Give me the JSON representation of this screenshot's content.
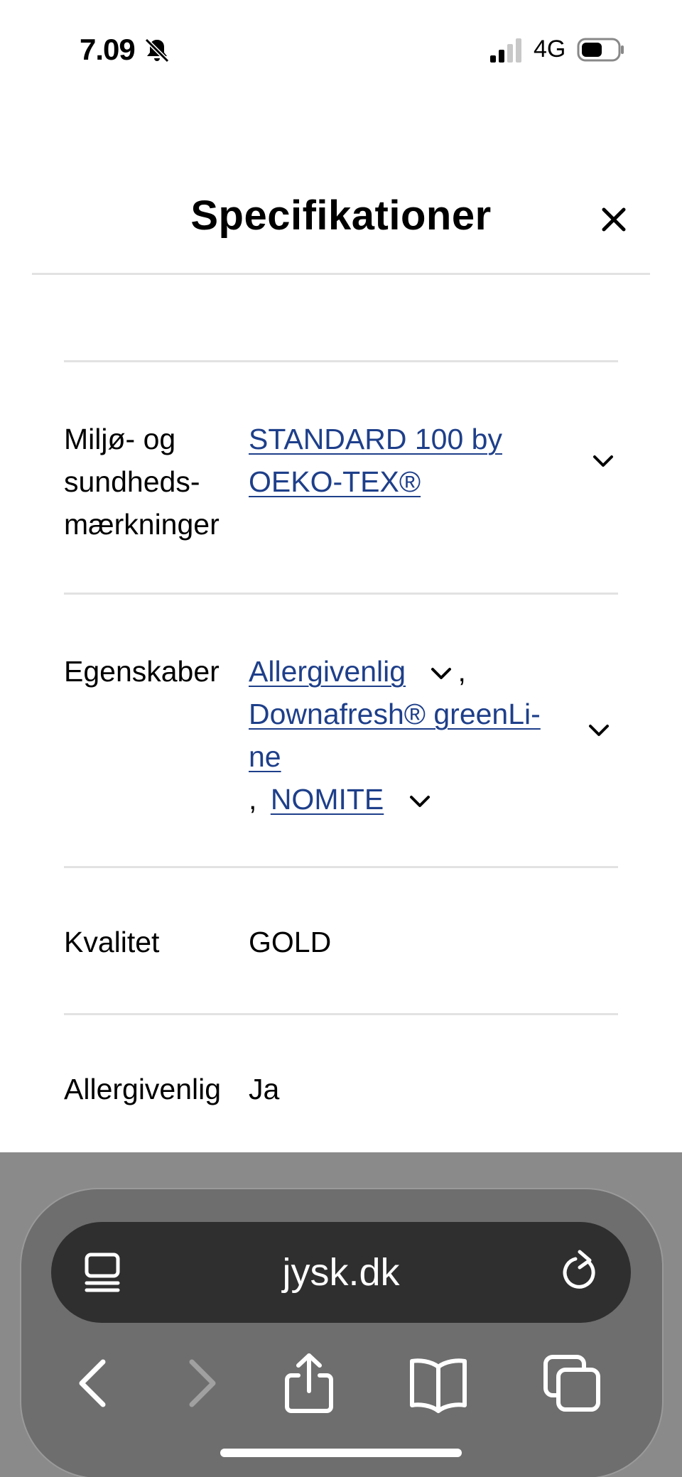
{
  "status_bar": {
    "time": "7.09",
    "network": "4G",
    "icons": [
      "bell-slash-icon",
      "signal-icon",
      "battery-icon"
    ]
  },
  "sheet": {
    "title": "Specifikationer",
    "close_icon": "close-icon"
  },
  "specs": {
    "rows": [
      {
        "label_lines": [
          "Miljø- og",
          "sundheds-",
          "mærkninger"
        ],
        "value_link_lines": [
          "STANDARD 100 by",
          "OEKO-TEX®"
        ]
      },
      {
        "label": "Egenskaber",
        "link1": "Allergivenlig",
        "sep1": ",",
        "link2_lines": [
          "Downafresh® greenLi-",
          "ne"
        ],
        "sep2": ",",
        "link3": "NOMITE"
      },
      {
        "label": "Kvalitet",
        "value": "GOLD"
      },
      {
        "label": "Allergivenlig",
        "value": "Ja"
      }
    ]
  },
  "browser": {
    "url": "jysk.dk",
    "toolbar": [
      "back-icon",
      "forward-icon",
      "share-icon",
      "bookmarks-icon",
      "tabs-icon"
    ]
  },
  "colors": {
    "link": "#1e3f8a",
    "divider": "#e2e2e2",
    "chrome_bg": "#8a8a8a",
    "address_bar": "#2f2f2f"
  }
}
